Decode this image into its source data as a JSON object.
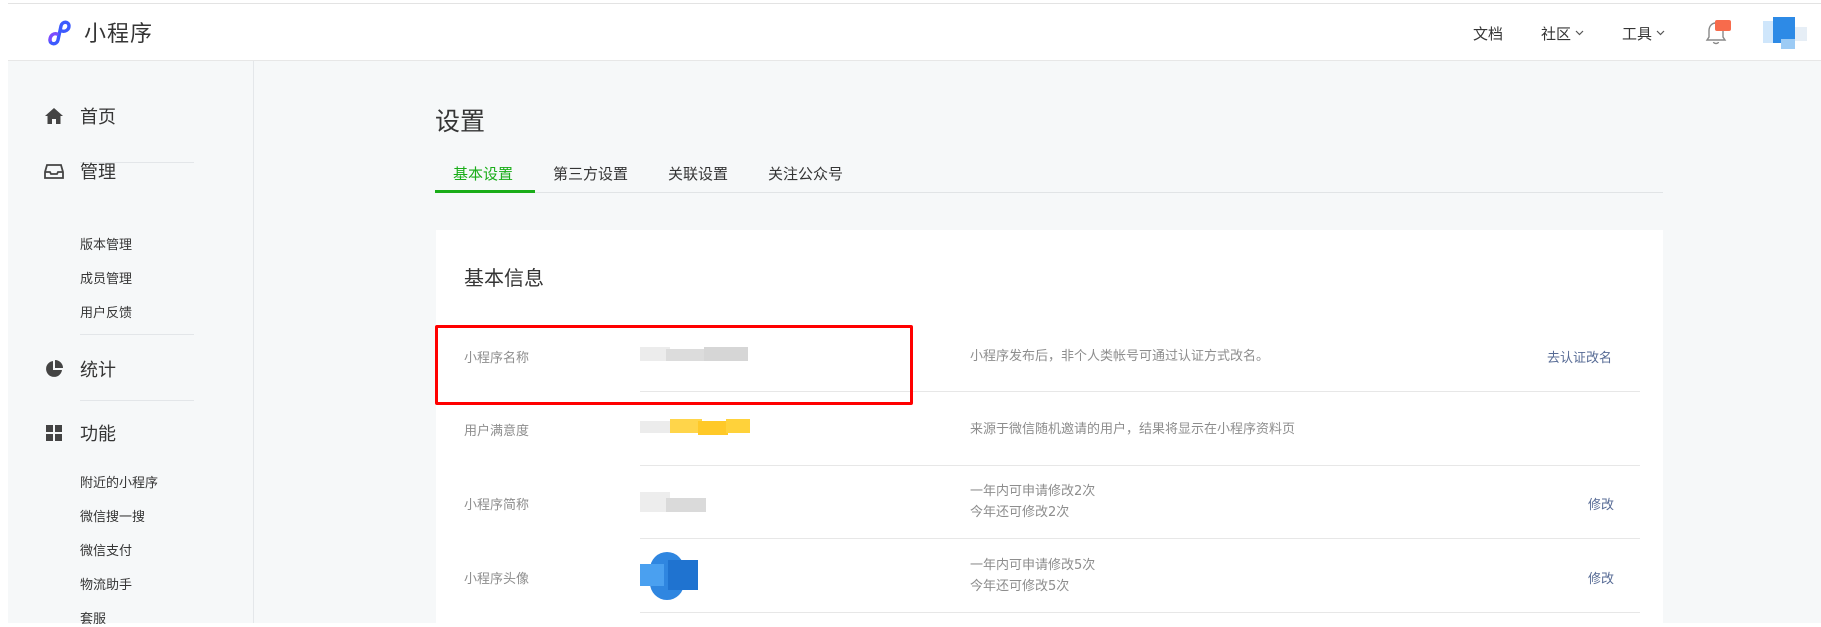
{
  "header": {
    "app_name": "小程序",
    "nav": [
      {
        "label": "文档",
        "has_dropdown": false
      },
      {
        "label": "社区",
        "has_dropdown": true
      },
      {
        "label": "工具",
        "has_dropdown": true
      }
    ],
    "brand_color": "#3d5afe",
    "notification_icon": "bell-icon"
  },
  "sidebar": {
    "sections": [
      {
        "label": "首页",
        "icon": "home-icon"
      },
      {
        "label": "管理",
        "icon": "inbox-icon",
        "items": [
          "版本管理",
          "成员管理",
          "用户反馈"
        ]
      },
      {
        "label": "统计",
        "icon": "pie-chart-icon"
      },
      {
        "label": "功能",
        "icon": "grid-icon",
        "items": [
          "附近的小程序",
          "微信搜一搜",
          "微信支付",
          "物流助手",
          "套服"
        ]
      }
    ]
  },
  "page": {
    "title": "设置",
    "tabs": [
      {
        "label": "基本设置",
        "active": true
      },
      {
        "label": "第三方设置",
        "active": false
      },
      {
        "label": "关联设置",
        "active": false
      },
      {
        "label": "关注公众号",
        "active": false
      }
    ],
    "accent_color": "#1aad19"
  },
  "basic_info": {
    "title": "基本信息",
    "rows": [
      {
        "label": "小程序名称",
        "desc": [
          "小程序发布后，非个人类帐号可通过认证方式改名。"
        ],
        "action": "去认证改名"
      },
      {
        "label": "用户满意度",
        "desc": [
          "来源于微信随机邀请的用户，结果将显示在小程序资料页"
        ],
        "action": ""
      },
      {
        "label": "小程序简称",
        "desc": [
          "一年内可申请修改2次",
          "今年还可修改2次"
        ],
        "action": "修改"
      },
      {
        "label": "小程序头像",
        "desc": [
          "一年内可申请修改5次",
          "今年还可修改5次"
        ],
        "action": "修改"
      }
    ],
    "link_color": "#576b95"
  }
}
